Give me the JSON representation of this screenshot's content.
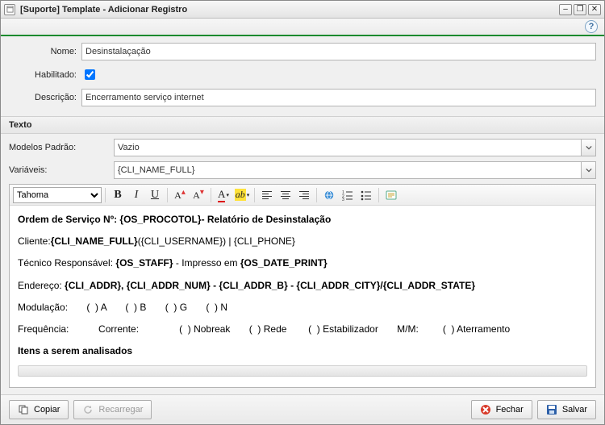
{
  "window": {
    "title": "[Suporte] Template - Adicionar Registro"
  },
  "form": {
    "labels": {
      "nome": "Nome:",
      "habilitado": "Habilitado:",
      "descricao": "Descrição:"
    },
    "values": {
      "nome": "Desinstalaçação",
      "habilitado": true,
      "descricao": "Encerramento serviço internet"
    }
  },
  "texto": {
    "title": "Texto",
    "labels": {
      "modelos": "Modelos Padrão:",
      "variaveis": "Variáveis:"
    },
    "values": {
      "modelos": "Vazio",
      "variaveis": "{CLI_NAME_FULL}"
    }
  },
  "editor": {
    "font": "Tahoma",
    "content": {
      "line1a": "Ordem de Serviço Nº: {OS_PROCOTOL}",
      "line1b": "- Relatório de Desinstalação",
      "line2a": "Cliente:",
      "line2b": "{CLI_NAME_FULL}",
      "line2c": "({CLI_USERNAME})  |  {CLI_PHONE}",
      "line3a": "Técnico Responsável: ",
      "line3b": "{OS_STAFF}",
      "line3c": " - Impresso em ",
      "line3d": "{OS_DATE_PRINT}",
      "line4a": "Endereço: ",
      "line4b": "{CLI_ADDR}, {CLI_ADDR_NUM} - {CLI_ADDR_B} - {CLI_ADDR_CITY}/{CLI_ADDR_STATE}",
      "line5": "Modulação:       (  ) A       (  ) B       (  ) G       (  ) N",
      "line6": "Frequência:           Corrente:               (  ) Nobreak       (  ) Rede        (  ) Estabilizador       M/M:         (  ) Aterramento",
      "line7": "Itens a serem analisados"
    }
  },
  "buttons": {
    "copiar": "Copiar",
    "recarregar": "Recarregar",
    "fechar": "Fechar",
    "salvar": "Salvar"
  }
}
